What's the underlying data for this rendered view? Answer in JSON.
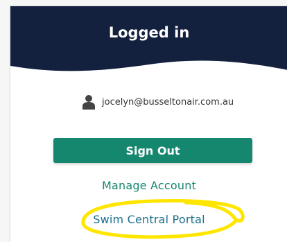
{
  "header": {
    "title": "Logged in"
  },
  "user": {
    "icon": "user-icon",
    "email": "jocelyn@busseltonair.com.au"
  },
  "actions": {
    "sign_out_label": "Sign Out",
    "manage_account_label": "Manage Account",
    "swim_portal_label": "Swim Central Portal"
  },
  "colors": {
    "header_bg": "#13213f",
    "primary": "#16876f",
    "link": "#16876f",
    "annotation": "#ffe600"
  }
}
